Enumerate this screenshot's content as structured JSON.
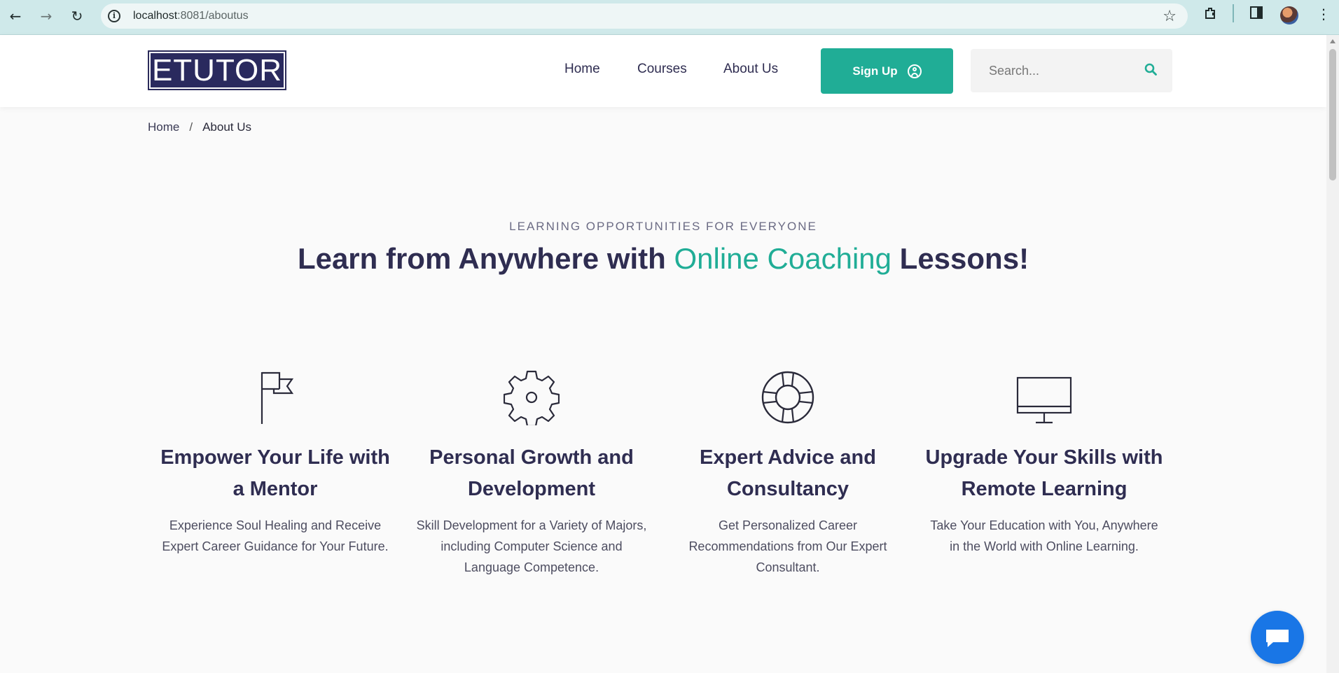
{
  "browser": {
    "url_host": "localhost",
    "url_path": ":8081/aboutus"
  },
  "header": {
    "logo_text": "ETUTOR",
    "nav": [
      "Home",
      "Courses",
      "About Us"
    ],
    "signup_label": "Sign Up",
    "search_placeholder": "Search..."
  },
  "breadcrumb": {
    "home": "Home",
    "separator": "/",
    "current": "About Us"
  },
  "hero": {
    "subtitle": "LEARNING OPPORTUNITIES FOR EVERYONE",
    "title_before": "Learn from Anywhere with ",
    "title_accent": "Online Coaching",
    "title_after": " Lessons!",
    "accent_color": "#20ad96"
  },
  "features": [
    {
      "icon": "flag-icon",
      "title": "Empower Your Life with a Mentor",
      "text": "Experience Soul Healing and Receive Expert Career Guidance for Your Future."
    },
    {
      "icon": "gear-icon",
      "title": "Personal Growth and Development",
      "text": "Skill Development for a Variety of Majors, including Computer Science and Language Competence."
    },
    {
      "icon": "lifebuoy-icon",
      "title": "Expert Advice and Consultancy",
      "text": "Get Personalized Career Recommendations from Our Expert Consultant."
    },
    {
      "icon": "monitor-icon",
      "title": "Upgrade Your Skills with Remote Learning",
      "text": "Take Your Education with You, Anywhere in the World with Online Learning."
    }
  ],
  "colors": {
    "brand_navy": "#2f2d51",
    "brand_teal": "#20ad96",
    "chat_blue": "#1976e6"
  }
}
